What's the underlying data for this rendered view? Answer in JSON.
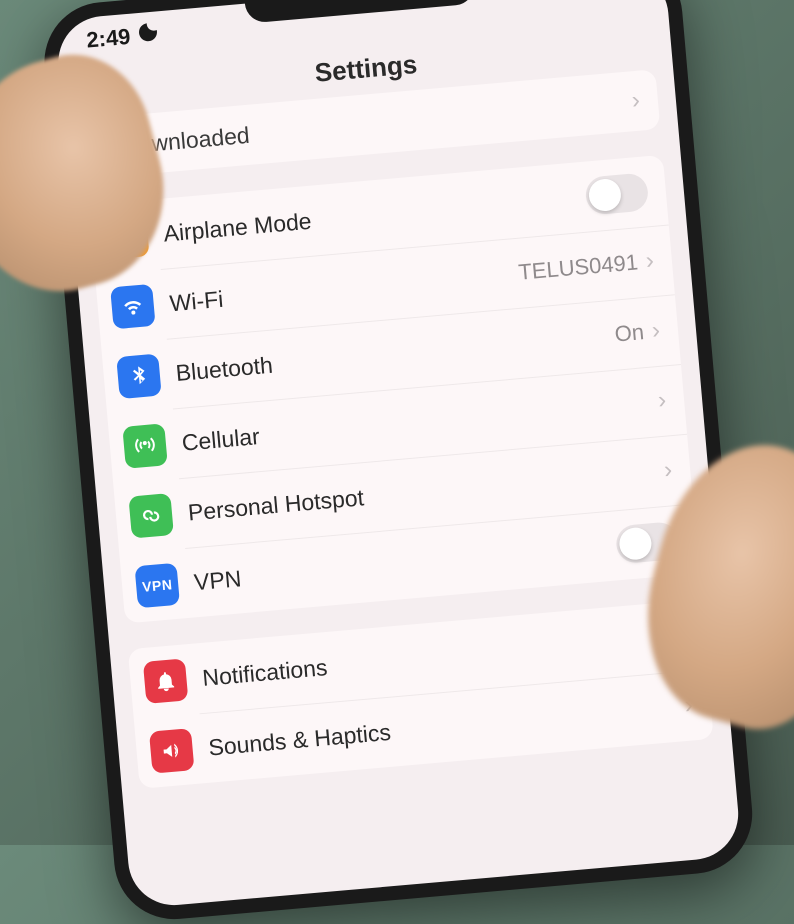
{
  "status": {
    "time": "2:49"
  },
  "header": {
    "title": "Settings"
  },
  "profile": {
    "label": "le Downloaded"
  },
  "network": {
    "airplane": {
      "label": "Airplane Mode"
    },
    "wifi": {
      "label": "Wi-Fi",
      "value": "TELUS0491"
    },
    "bluetooth": {
      "label": "Bluetooth",
      "value": "On"
    },
    "cellular": {
      "label": "Cellular"
    },
    "hotspot": {
      "label": "Personal Hotspot"
    },
    "vpn": {
      "label": "VPN",
      "badge": "VPN"
    }
  },
  "general": {
    "notifications": {
      "label": "Notifications"
    },
    "sounds": {
      "label": "Sounds & Haptics"
    }
  }
}
